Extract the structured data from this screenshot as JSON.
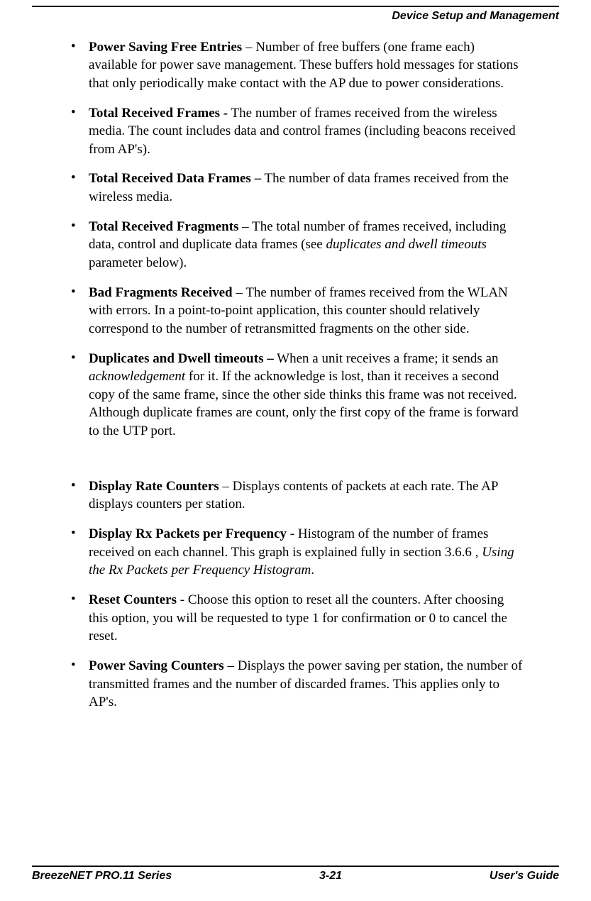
{
  "header": {
    "section": "Device Setup and Management"
  },
  "items": [
    {
      "term": "Power Saving Free Entries",
      "sep": " – ",
      "desc_before": "Number of free buffers (one frame each) available for power save management. These buffers hold messages for stations that only periodically make contact with the AP due to power considerations.",
      "italic": "",
      "desc_after": ""
    },
    {
      "term": "Total Received Frames -",
      "sep": " ",
      "desc_before": "The number of frames received from the wireless media. The count includes data and control frames (including beacons received from AP's).",
      "italic": "",
      "desc_after": ""
    },
    {
      "term": "Total Received Data Frames –",
      "sep": " ",
      "desc_before": "The number of data frames received from the wireless media.",
      "italic": "",
      "desc_after": ""
    },
    {
      "term": "Total Received Fragments",
      "sep": " – ",
      "desc_before": "The total number of frames received, including data, control and duplicate data frames (see ",
      "italic": "duplicates and dwell timeouts",
      "desc_after": " parameter below)."
    },
    {
      "term": "Bad Fragments Received",
      "sep": " – ",
      "desc_before": "The number of frames received from the WLAN with errors. In a point-to-point application, this counter should relatively correspond to the number of retransmitted fragments on the other side.",
      "italic": "",
      "desc_after": ""
    },
    {
      "term": "Duplicates and Dwell timeouts –",
      "sep": " ",
      "desc_before": "When a unit receives a frame; it sends an ",
      "italic": "acknowledgement",
      "desc_after": " for it. If the acknowledge is lost, than it receives a second copy of the same frame, since the other side thinks this frame was not received. Although duplicate frames are count, only the first copy of the frame is forward to the UTP port."
    }
  ],
  "items2": [
    {
      "term": "Display Rate Counters",
      "sep": " – ",
      "desc_before": "Displays contents of packets at each rate. The AP displays counters per station.",
      "italic": "",
      "desc_after": ""
    },
    {
      "term": "Display Rx Packets per Frequency",
      "sep": " - ",
      "desc_before": "Histogram of the number of frames received on each channel. This graph is explained fully in section 3.6.6 , ",
      "italic": "Using the Rx Packets per Frequency Histogram",
      "desc_after": "."
    },
    {
      "term": "Reset Counters",
      "sep": "  - ",
      "desc_before": "Choose this option to reset all the counters. After choosing this option, you will be requested to type 1 for confirmation or 0 to cancel the reset.",
      "italic": "",
      "desc_after": ""
    },
    {
      "term": "Power Saving Counters",
      "sep": " – ",
      "desc_before": "Displays the power saving per station, the number of transmitted frames and the number of discarded frames. This applies only to AP's.",
      "italic": "",
      "desc_after": ""
    }
  ],
  "footer": {
    "left": "BreezeNET PRO.11 Series",
    "center": "3-21",
    "right": "User's Guide"
  }
}
